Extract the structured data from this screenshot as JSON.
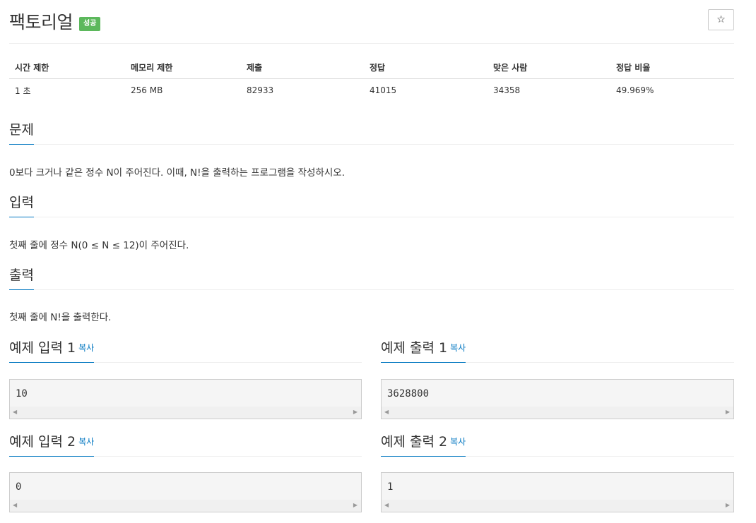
{
  "problem": {
    "title": "팩토리얼",
    "badge": "성공",
    "star_icon": "☆"
  },
  "info": {
    "headers": [
      "시간 제한",
      "메모리 제한",
      "제출",
      "정답",
      "맞은 사람",
      "정답 비율"
    ],
    "values": [
      "1 초",
      "256 MB",
      "82933",
      "41015",
      "34358",
      "49.969%"
    ]
  },
  "sections": {
    "problem": {
      "heading": "문제",
      "text": "0보다 크거나 같은 정수 N이 주어진다. 이때, N!을 출력하는 프로그램을 작성하시오."
    },
    "input": {
      "heading": "입력",
      "text": "첫째 줄에 정수 N(0 ≤ N ≤ 12)이 주어진다."
    },
    "output": {
      "heading": "출력",
      "text": "첫째 줄에 N!을 출력한다."
    }
  },
  "samples": {
    "copy_label": "복사",
    "input1": {
      "heading": "예제 입력 1",
      "value": "10"
    },
    "output1": {
      "heading": "예제 출력 1",
      "value": "3628800"
    },
    "input2": {
      "heading": "예제 입력 2",
      "value": "0"
    },
    "output2": {
      "heading": "예제 출력 2",
      "value": "1"
    },
    "scroll_left": "◀",
    "scroll_right": "▶"
  }
}
